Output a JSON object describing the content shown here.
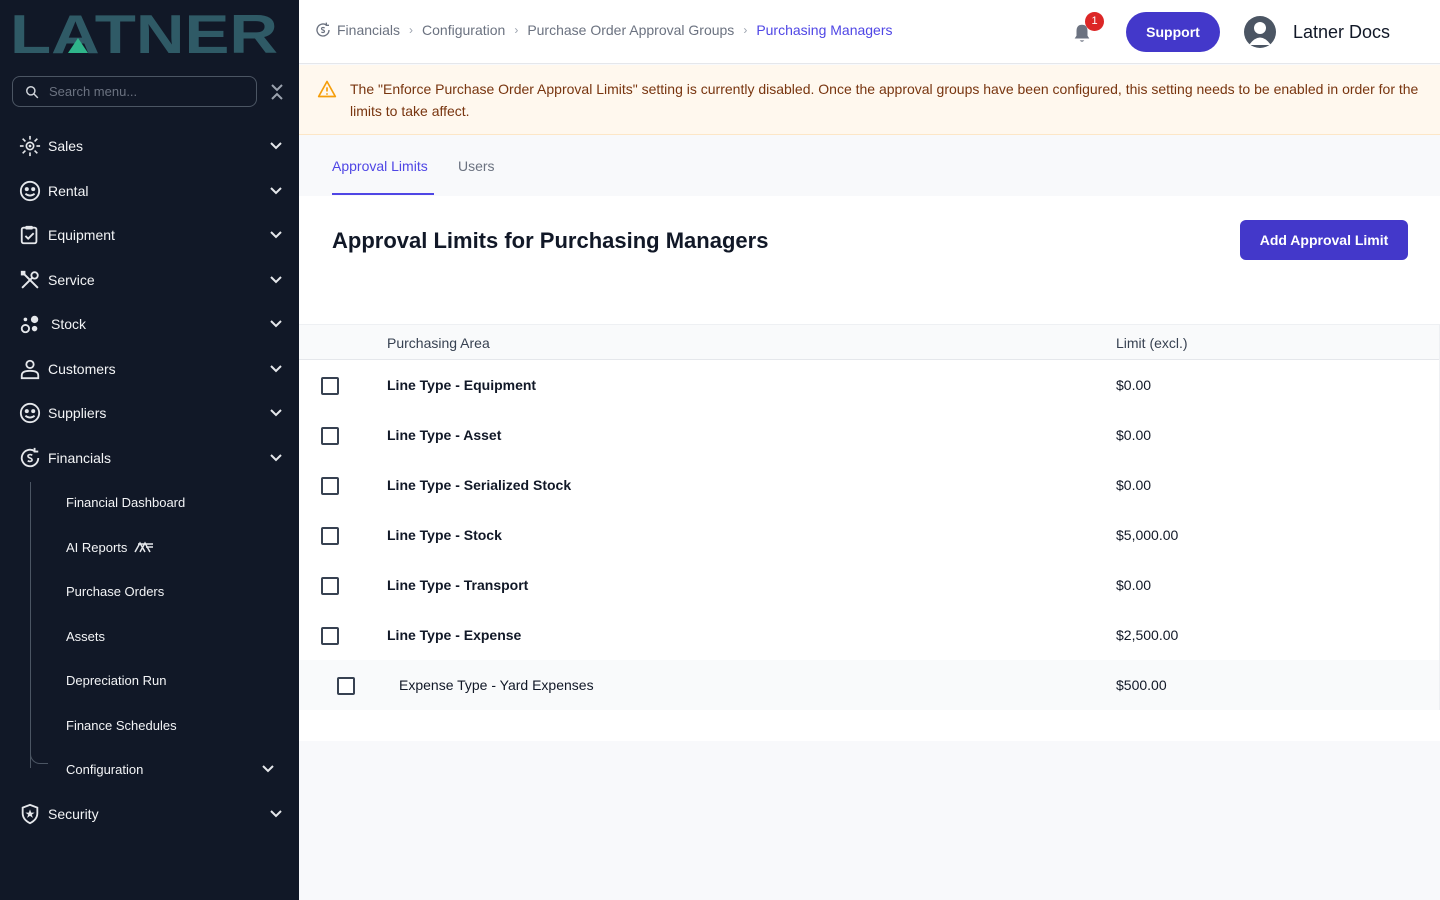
{
  "brand": {
    "logo_text": "LATNER",
    "logo_color": "#2f5a66",
    "accent": "#2fb58a"
  },
  "sidebar": {
    "search_placeholder": "Search menu...",
    "items": [
      {
        "label": "Sales",
        "icon": "sales-icon"
      },
      {
        "label": "Rental",
        "icon": "rental-icon"
      },
      {
        "label": "Equipment",
        "icon": "equipment-icon"
      },
      {
        "label": "Service",
        "icon": "service-icon"
      },
      {
        "label": "Stock",
        "icon": "stock-icon"
      },
      {
        "label": "Customers",
        "icon": "customers-icon"
      },
      {
        "label": "Suppliers",
        "icon": "suppliers-icon"
      },
      {
        "label": "Financials",
        "icon": "financials-icon"
      },
      {
        "label": "Security",
        "icon": "security-icon"
      }
    ],
    "financials_sub": [
      {
        "label": "Financial Dashboard"
      },
      {
        "label": "AI Reports"
      },
      {
        "label": "Purchase Orders"
      },
      {
        "label": "Assets"
      },
      {
        "label": "Depreciation Run"
      },
      {
        "label": "Finance Schedules"
      },
      {
        "label": "Configuration"
      }
    ]
  },
  "header": {
    "breadcrumb": [
      "Financials",
      "Configuration",
      "Purchase Order Approval Groups",
      "Purchasing Managers"
    ],
    "notification_count": "1",
    "support_label": "Support",
    "user_name": "Latner Docs"
  },
  "alert": {
    "text": "The \"Enforce Purchase Order Approval Limits\" setting is currently disabled. Once the approval groups have been configured, this setting needs to be enabled in order for the limits to take affect."
  },
  "tabs": [
    {
      "label": "Approval Limits",
      "active": true
    },
    {
      "label": "Users",
      "active": false
    }
  ],
  "main": {
    "heading_prefix": "Approval Limits for ",
    "heading_group": "Purchasing Managers",
    "add_button": "Add Approval Limit"
  },
  "table": {
    "columns": [
      "Purchasing Area",
      "Limit (excl.)"
    ],
    "rows": [
      {
        "area": "Line Type - Equipment",
        "limit": "$0.00",
        "level": 0
      },
      {
        "area": "Line Type - Asset",
        "limit": "$0.00",
        "level": 0
      },
      {
        "area": "Line Type - Serialized Stock",
        "limit": "$0.00",
        "level": 0
      },
      {
        "area": "Line Type - Stock",
        "limit": "$5,000.00",
        "level": 0
      },
      {
        "area": "Line Type - Transport",
        "limit": "$0.00",
        "level": 0
      },
      {
        "area": "Line Type - Expense",
        "limit": "$2,500.00",
        "level": 0
      },
      {
        "area": "Expense Type - Yard Expenses",
        "limit": "$500.00",
        "level": 1
      }
    ]
  }
}
